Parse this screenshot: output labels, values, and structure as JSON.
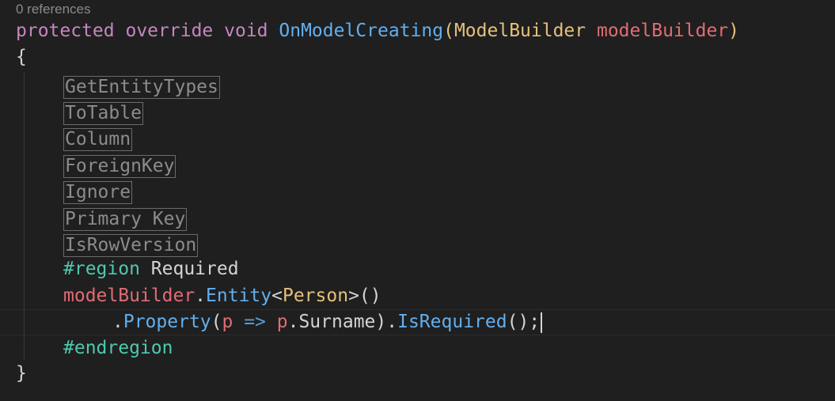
{
  "codelens": {
    "references": "0 references"
  },
  "signature": {
    "modifier1": "protected",
    "modifier2": "override",
    "return_type": "void",
    "method_name": "OnModelCreating",
    "open_paren": "(",
    "param_type": "ModelBuilder",
    "param_name": "modelBuilder",
    "close_paren": ")"
  },
  "braces": {
    "open": "{",
    "close": "}"
  },
  "collapsed_regions": [
    "GetEntityTypes",
    "ToTable",
    "Column",
    "ForeignKey",
    "Ignore",
    "Primary Key",
    "IsRowVersion"
  ],
  "region_block": {
    "region_keyword": "#region",
    "region_name": "Required",
    "line1": {
      "target": "modelBuilder",
      "dot": ".",
      "method": "Entity",
      "lt": "<",
      "generic_type": "Person",
      "gt_parens": ">()"
    },
    "line2": {
      "dot": ".",
      "method": "Property",
      "open_paren": "(",
      "lambda_param": "p",
      "arrow": " => ",
      "lambda_target": "p",
      "member": ".Surname",
      "close_paren": ")",
      "dot2": ".",
      "method2": "IsRequired",
      "tail": "();"
    },
    "endregion_keyword": "#endregion"
  }
}
